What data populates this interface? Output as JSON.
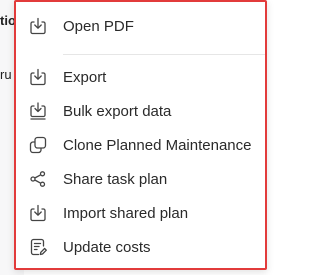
{
  "background": {
    "line1": "tio",
    "line2": "ru"
  },
  "menu": {
    "border_color": "#e23b3b",
    "items": [
      {
        "label": "Open PDF",
        "icon": "download-tray-icon"
      },
      {
        "label": "Export",
        "icon": "download-tray-icon"
      },
      {
        "label": "Bulk export data",
        "icon": "bulk-download-icon"
      },
      {
        "label": "Clone Planned Maintenance",
        "icon": "clone-icon"
      },
      {
        "label": "Share task plan",
        "icon": "share-icon"
      },
      {
        "label": "Import shared plan",
        "icon": "download-tray-icon"
      },
      {
        "label": "Update costs",
        "icon": "receipt-edit-icon"
      }
    ]
  }
}
